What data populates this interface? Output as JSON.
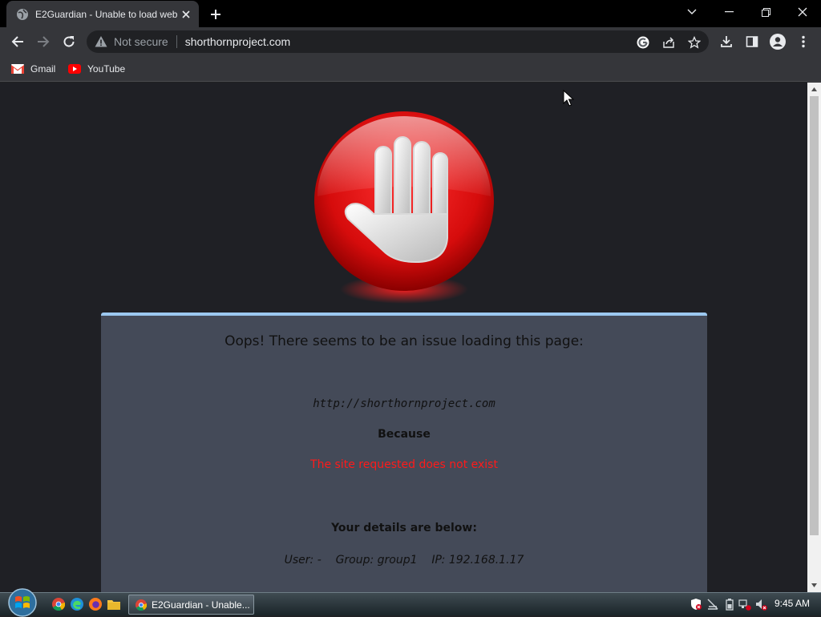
{
  "browser": {
    "tab_title": "E2Guardian - Unable to load web",
    "omnibox": {
      "security_label": "Not secure",
      "url": "shorthornproject.com"
    },
    "bookmarks": [
      {
        "label": "Gmail",
        "icon": "gmail-icon"
      },
      {
        "label": "YouTube",
        "icon": "youtube-icon"
      }
    ]
  },
  "page": {
    "heading": "Oops! There seems to be an issue loading this page:",
    "requested_url": "http://shorthornproject.com",
    "because_label": "Because",
    "reason": "The site requested does not exist",
    "details_heading": "Your details are below:",
    "user_line": "User: -    Group: group1    IP: 192.168.1.17",
    "reason_color": "#ff1a1a",
    "panel_top_color": "#9cc8f0"
  },
  "taskbar": {
    "task_label": "E2Guardian - Unable...",
    "clock": "9:45 AM"
  }
}
